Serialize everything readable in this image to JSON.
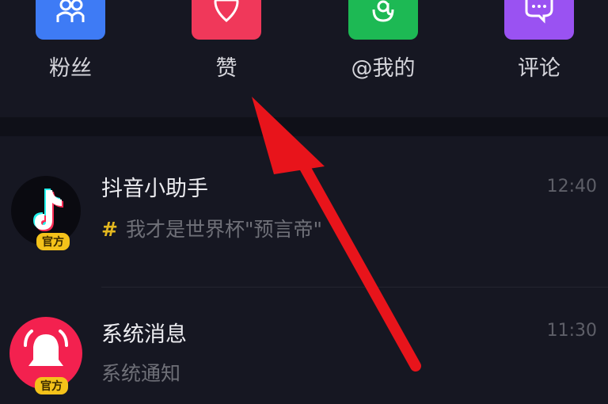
{
  "categories": [
    {
      "key": "fans",
      "label": "粉丝",
      "color": "#3e7bf5",
      "icon": "users-icon"
    },
    {
      "key": "likes",
      "label": "赞",
      "color": "#f0385a",
      "icon": "heart-icon"
    },
    {
      "key": "mention",
      "label": "@我的",
      "color": "#1db954",
      "icon": "at-sign-icon"
    },
    {
      "key": "comments",
      "label": "评论",
      "color": "#9a52f2",
      "icon": "speech-bubble-icon"
    }
  ],
  "messages": [
    {
      "title": "抖音小助手",
      "subtitle": "我才是世界杯\"预言帝\"",
      "subtitle_prefix": "#",
      "time": "12:40",
      "badge": "官方",
      "avatar_icon": "tiktok-logo-icon"
    },
    {
      "title": "系统消息",
      "subtitle": "系统通知",
      "time": "11:30",
      "badge": "官方",
      "avatar_icon": "bell-icon"
    }
  ],
  "annotation": {
    "color": "#e8141b",
    "icon": "red-arrow-annotation"
  }
}
